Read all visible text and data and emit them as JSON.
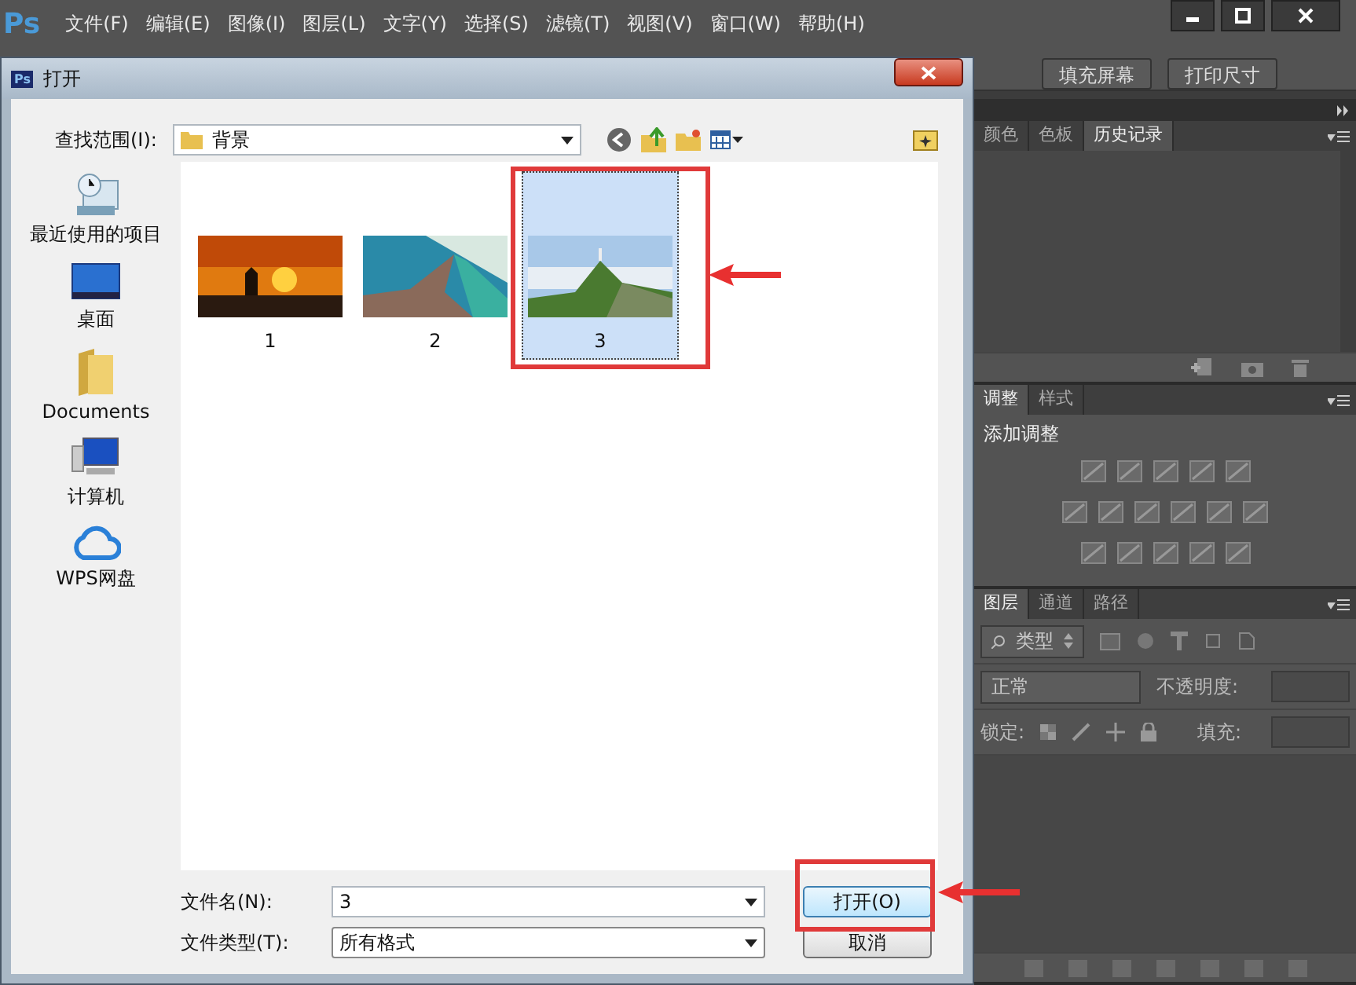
{
  "app": {
    "logo": "Ps",
    "menu": [
      "文件(F)",
      "编辑(E)",
      "图像(I)",
      "图层(L)",
      "文字(Y)",
      "选择(S)",
      "滤镜(T)",
      "视图(V)",
      "窗口(W)",
      "帮助(H)"
    ],
    "options_bar": [
      "填充屏幕",
      "打印尺寸"
    ]
  },
  "dialog": {
    "icon": "Ps",
    "title": "打开",
    "look_in_label": "查找范围(I):",
    "look_in": "背景",
    "places": [
      {
        "label": "最近使用的项目",
        "kind": "recent"
      },
      {
        "label": "桌面",
        "kind": "desktop"
      },
      {
        "label": "Documents",
        "kind": "folder"
      },
      {
        "label": "计算机",
        "kind": "computer"
      },
      {
        "label": "WPS网盘",
        "kind": "cloud"
      }
    ],
    "files": [
      {
        "name": "1",
        "selected": false
      },
      {
        "name": "2",
        "selected": false
      },
      {
        "name": "3",
        "selected": true
      }
    ],
    "file_name_label": "文件名(N):",
    "file_name": "3",
    "file_type_label": "文件类型(T):",
    "file_type": "所有格式",
    "buttons": [
      "打开(O)",
      "取消"
    ]
  },
  "panels": {
    "history_tabs": [
      {
        "label": "颜色",
        "selected": false
      },
      {
        "label": "色板",
        "selected": false
      },
      {
        "label": "历史记录",
        "selected": true
      }
    ],
    "adjust_tabs": [
      {
        "label": "调整",
        "selected": true
      },
      {
        "label": "样式",
        "selected": false
      }
    ],
    "adjust_title": "添加调整",
    "layers_tabs": [
      {
        "label": "图层",
        "selected": true
      },
      {
        "label": "通道",
        "selected": false
      },
      {
        "label": "路径",
        "selected": false
      }
    ],
    "filter": "类型",
    "blend_mode": "正常",
    "opacity_label": "不透明度:",
    "lock_label": "锁定:",
    "fill_label": "填充:"
  }
}
